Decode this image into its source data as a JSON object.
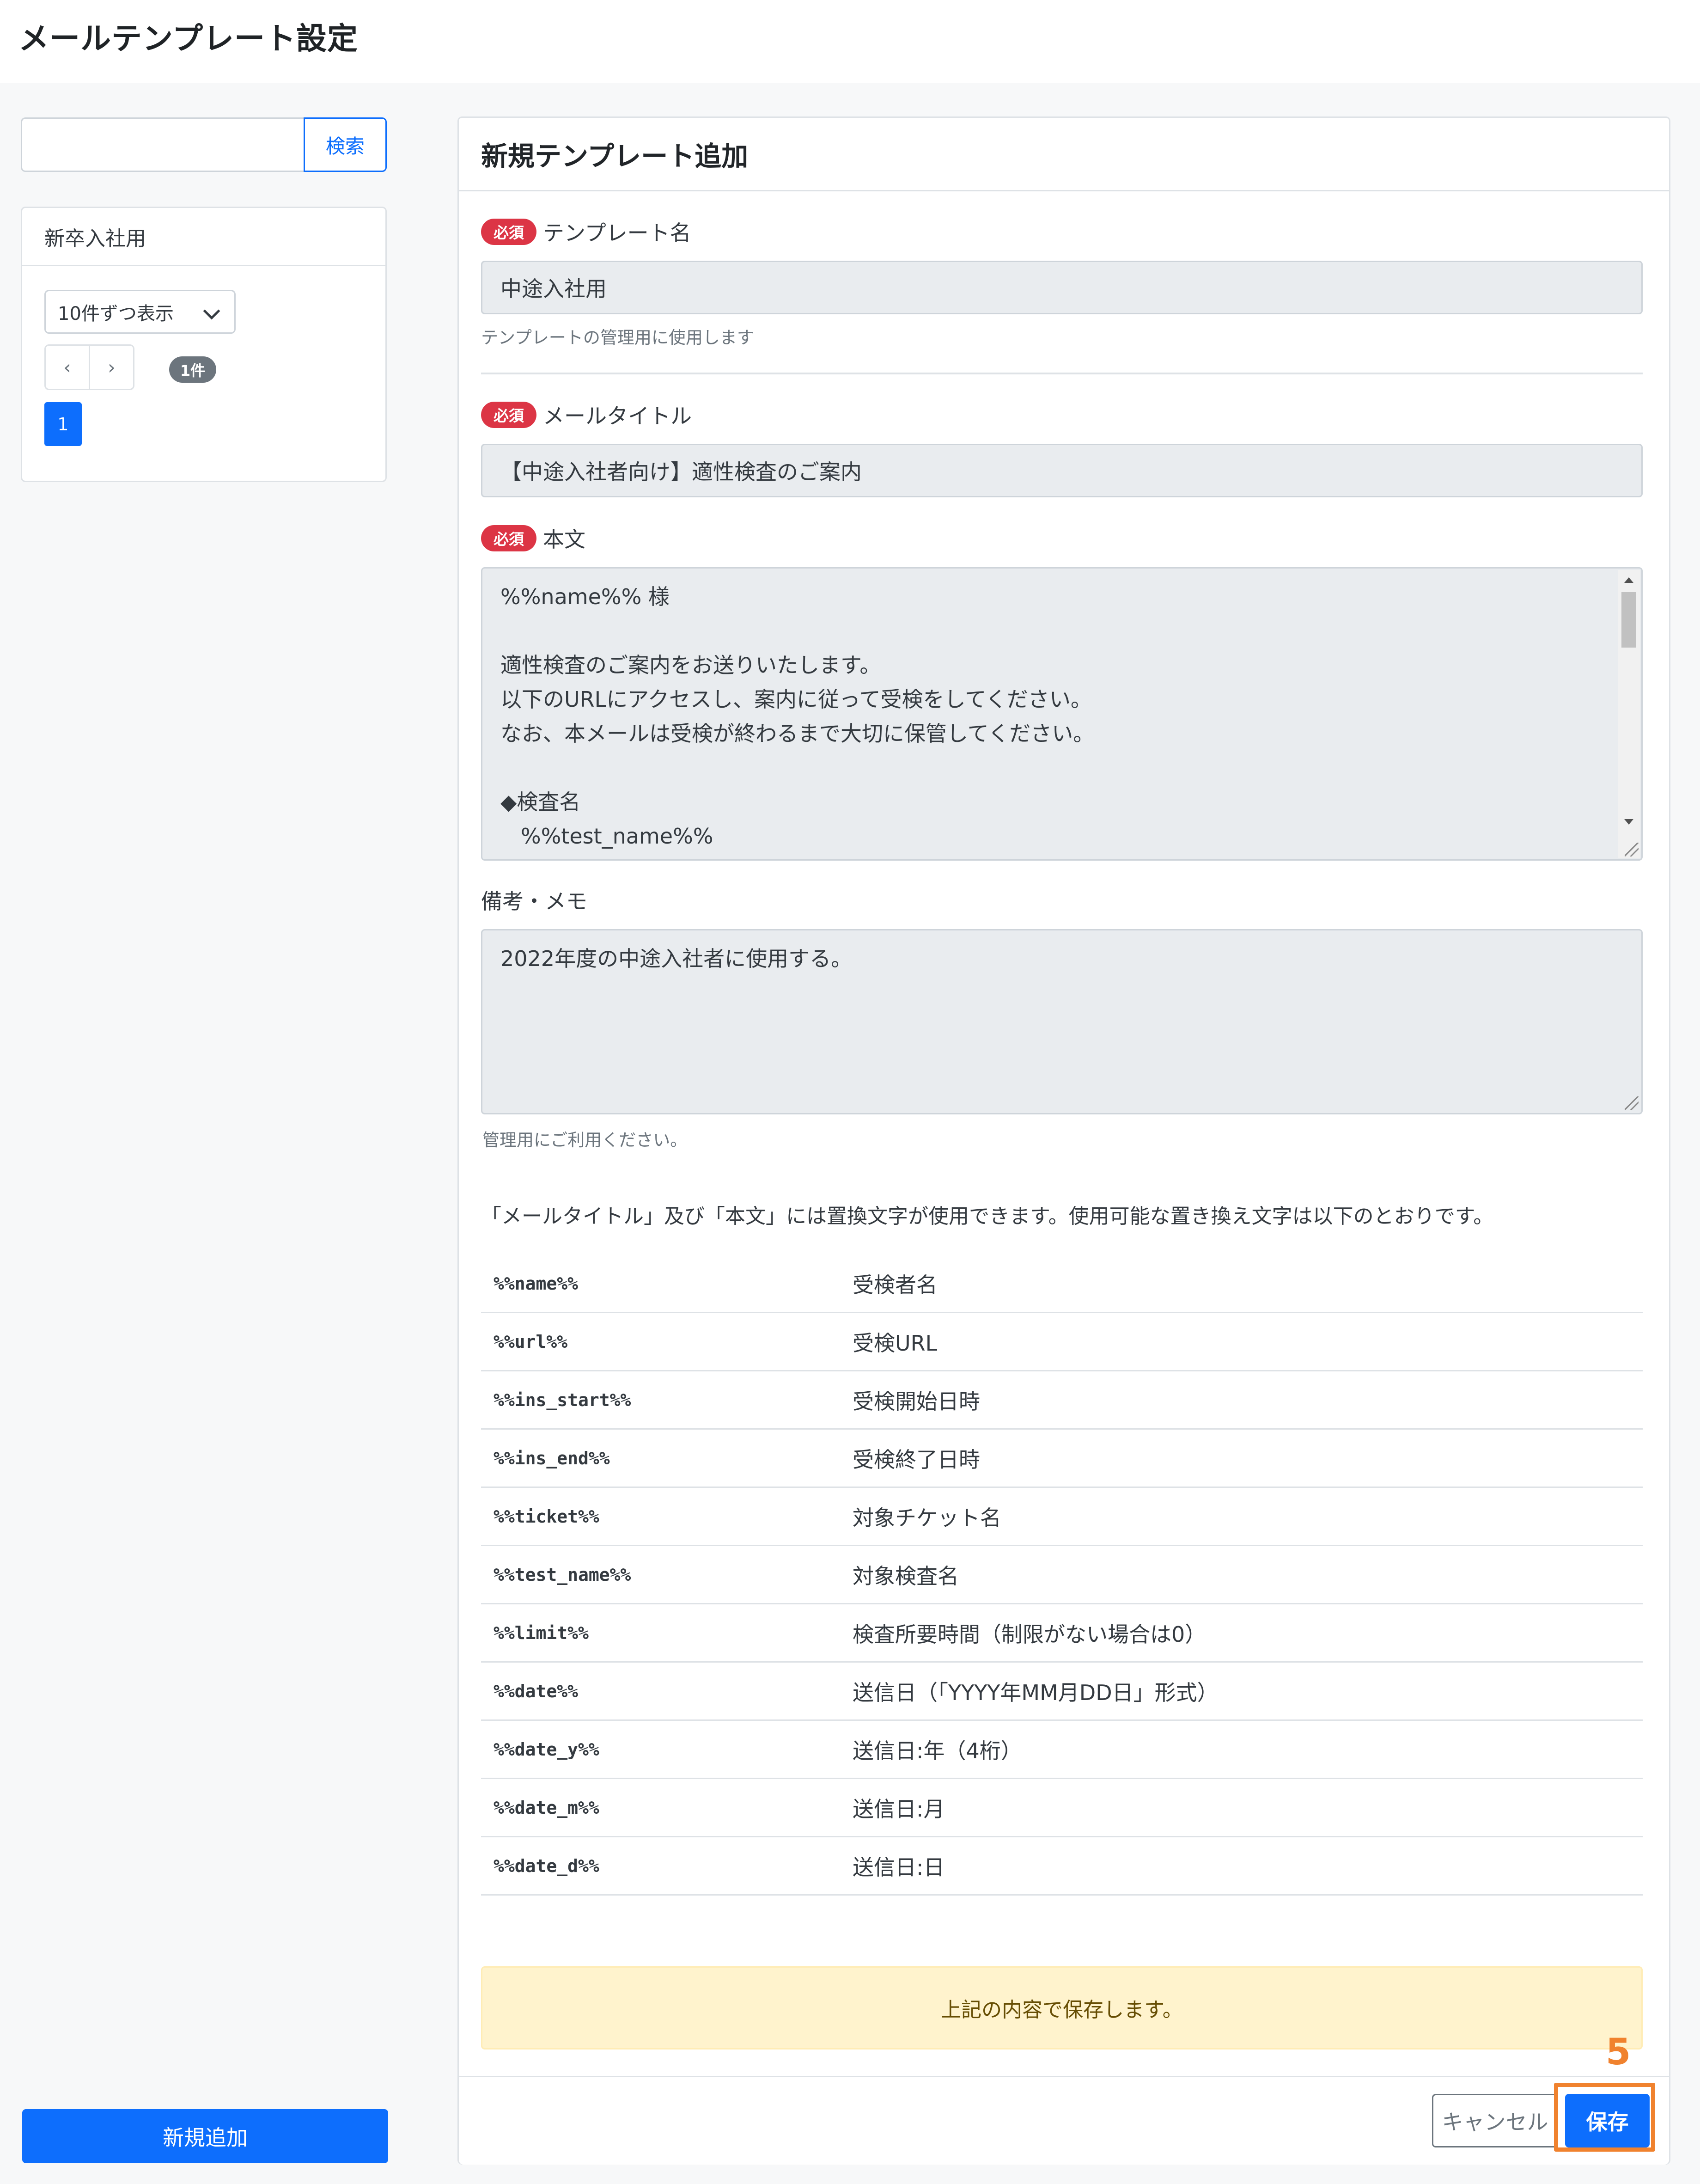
{
  "page": {
    "title": "メールテンプレート設定"
  },
  "sidebar": {
    "search": {
      "placeholder": "",
      "value": "",
      "button_label": "検索"
    },
    "template_list": {
      "items": [
        {
          "label": "新卒入社用"
        }
      ],
      "per_page_label": "10件ずつ表示",
      "prev_icon": "‹",
      "next_icon": "›",
      "count_badge": "1件",
      "current_page": "1"
    },
    "add_button_label": "新規追加"
  },
  "form": {
    "title": "新規テンプレート追加",
    "required_badge": "必須",
    "template_name": {
      "label": "テンプレート名",
      "value": "中途入社用",
      "help": "テンプレートの管理用に使用します"
    },
    "mail_title": {
      "label": "メールタイトル",
      "value": "【中途入社者向け】適性検査のご案内"
    },
    "body": {
      "label": "本文",
      "lines": [
        "%%name%% 様",
        "",
        "適性検査のご案内をお送りいたします。",
        "以下のURLにアクセスし、案内に従って受検をしてください。",
        "なお、本メールは受検が終わるまで大切に保管してください。",
        "",
        "◆検査名",
        "   %%test_name%%"
      ]
    },
    "memo": {
      "label": "備考・メモ",
      "value": "2022年度の中途入社者に使用する。",
      "help": "管理用にご利用ください。"
    },
    "replacement_intro": "「メールタイトル」及び「本文」には置換文字が使用できます。使用可能な置き換え文字は以下のとおりです。",
    "replacements": [
      {
        "key": "%%name%%",
        "desc": "受検者名"
      },
      {
        "key": "%%url%%",
        "desc": "受検URL"
      },
      {
        "key": "%%ins_start%%",
        "desc": "受検開始日時"
      },
      {
        "key": "%%ins_end%%",
        "desc": "受検終了日時"
      },
      {
        "key": "%%ticket%%",
        "desc": "対象チケット名"
      },
      {
        "key": "%%test_name%%",
        "desc": "対象検査名"
      },
      {
        "key": "%%limit%%",
        "desc": "検査所要時間（制限がない場合は0）"
      },
      {
        "key": "%%date%%",
        "desc": "送信日（「YYYY年MM月DD日」形式）"
      },
      {
        "key": "%%date_y%%",
        "desc": "送信日:年（4桁）"
      },
      {
        "key": "%%date_m%%",
        "desc": "送信日:月"
      },
      {
        "key": "%%date_d%%",
        "desc": "送信日:日"
      }
    ],
    "save_notice": "上記の内容で保存します。",
    "cancel_label": "キャンセル",
    "save_label": "保存"
  },
  "annotation": {
    "step_number": "5",
    "color": "#f0822e"
  },
  "colors": {
    "primary": "#0d6efd",
    "danger": "#dc3545",
    "warning_bg": "#fff3cd"
  }
}
